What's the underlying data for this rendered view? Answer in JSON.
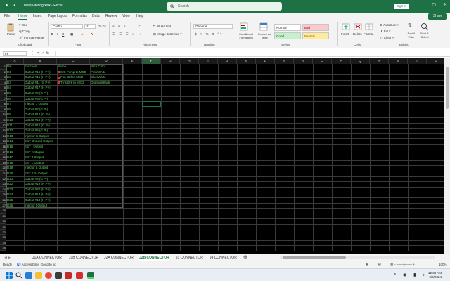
{
  "window": {
    "filename": "holley-wiring.xlsx - Excel",
    "search_placeholder": "Search",
    "signin": "Sign in"
  },
  "menu_tabs": [
    "File",
    "Home",
    "Insert",
    "Page Layout",
    "Formulas",
    "Data",
    "Review",
    "View",
    "Help"
  ],
  "share_label": "Share",
  "ribbon": {
    "clipboard": {
      "paste": "Paste",
      "cut": "Cut",
      "copy": "Copy",
      "format_painter": "Format Painter",
      "label": "Clipboard"
    },
    "font": {
      "name": "Calibri",
      "size": "11",
      "label": "Font"
    },
    "alignment": {
      "wrap": "Wrap Text",
      "merge": "Merge & Center",
      "label": "Alignment"
    },
    "number": {
      "format": "General",
      "label": "Number"
    },
    "styles": {
      "conditional": "Conditional Formatting",
      "format_table": "Format as Table",
      "normal": "Normal",
      "bad": "Bad",
      "good": "Good",
      "neutral": "Neutral",
      "label": "Styles"
    },
    "cells": {
      "insert": "Insert",
      "delete": "Delete",
      "format": "Format",
      "label": "Cells"
    },
    "editing": {
      "autosum": "AutoSum",
      "fill": "Fill",
      "clear": "Clear",
      "sort": "Sort & Filter",
      "find": "Find & Select",
      "label": "Editing"
    }
  },
  "formula_bar": {
    "name_box": "F8",
    "content": ""
  },
  "columns": [
    "A",
    "B",
    "C",
    "D",
    "E",
    "F",
    "G",
    "H",
    "I",
    "J",
    "K",
    "L",
    "M",
    "N",
    "O",
    "P",
    "Q",
    "R",
    "S",
    "T",
    "U",
    "V"
  ],
  "selected_column": "F",
  "row_count": 35,
  "headers": [
    "Pin",
    "Function",
    "Name",
    "Wire Color"
  ],
  "rows": [
    [
      "D1",
      "Output #16 (H P+)",
      "S/C Pump to MSD",
      "Pink/White"
    ],
    [
      "D2",
      "Output #15 (H P+)",
      "Fan Ctrl to MSD",
      "Blue/White"
    ],
    [
      "D3",
      "Output #11 (G P+)",
      "Trns Brk to MSD",
      "Orange/Black"
    ],
    [
      "D4",
      "Output #17 (H P+)",
      "",
      ""
    ],
    [
      "D5",
      "Output #9 (G P-)",
      "",
      ""
    ],
    [
      "D6",
      "Output #6 (G P-)",
      "",
      ""
    ],
    [
      "D7",
      "Injector J Output",
      "",
      ""
    ],
    [
      "D8",
      "Output #7 (G P-)",
      "",
      ""
    ],
    [
      "D9",
      "Output #12 (G P-)",
      "",
      ""
    ],
    [
      "D10",
      "Output #18 (H P+)",
      "",
      ""
    ],
    [
      "D11",
      "Output #10 (G P-)",
      "",
      ""
    ],
    [
      "D12",
      "Output #5 (G P-)",
      "",
      ""
    ],
    [
      "D13",
      "Injector K Output",
      "",
      ""
    ],
    [
      "D14",
      "EST Ground Output",
      "",
      ""
    ],
    [
      "D15",
      "EST I Output",
      "",
      ""
    ],
    [
      "D16",
      "EST K Output",
      "",
      ""
    ],
    [
      "D17",
      "EST J Output",
      "",
      ""
    ],
    [
      "D18",
      "EST L Output",
      "",
      ""
    ],
    [
      "D19",
      "Injector L Output",
      "",
      ""
    ],
    [
      "D20",
      "EST 12V Output",
      "",
      ""
    ],
    [
      "D21",
      "Output #8 (G P-)",
      "",
      ""
    ],
    [
      "D22",
      "Output #19 (H P+)",
      "",
      ""
    ],
    [
      "D23",
      "Output #20 (H P+)",
      "",
      ""
    ],
    [
      "D24",
      "Output #13 (H P+)",
      "",
      ""
    ],
    [
      "D25",
      "Output #14 (H P+)",
      "",
      ""
    ],
    [
      "D26",
      "Injector I Output",
      "",
      ""
    ]
  ],
  "sheet_tabs": [
    "J1A CONNECTOR",
    "J1B CONNECTOR",
    "J2A CONNECTOR",
    "J2B CONNECTOR",
    "J3 CONNECTOR",
    "J4 CONNECTOR"
  ],
  "active_sheet": "J2B CONNECTOR",
  "status": {
    "ready": "Ready",
    "accessibility": "Accessibility: Good to go",
    "zoom": "100%"
  },
  "clock": {
    "time": "12:38 AM",
    "date": "5/5/2024"
  },
  "colors": {
    "accent": "#1e7145",
    "cell_text": "#5fd35f",
    "grid_bg": "#000000"
  }
}
